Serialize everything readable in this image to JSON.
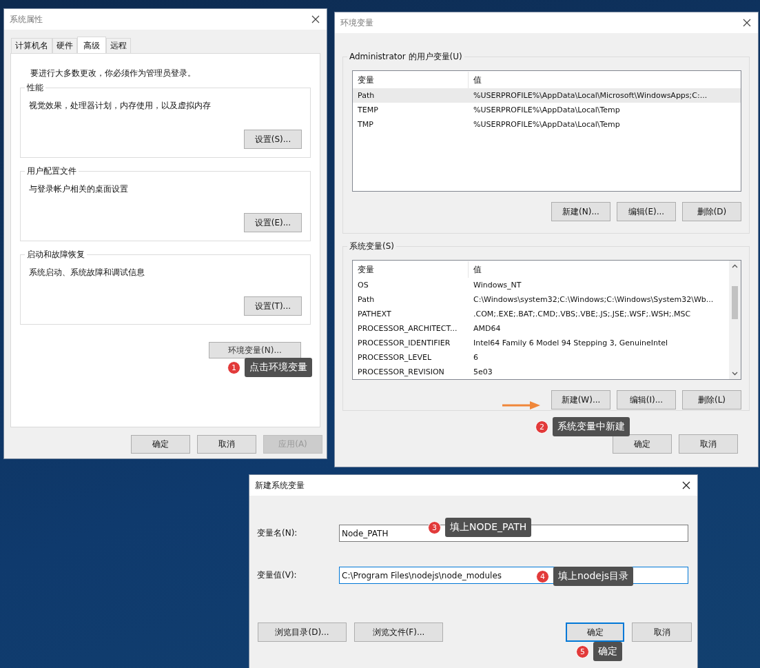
{
  "system_properties": {
    "title": "系统属性",
    "tabs": [
      {
        "label": "计算机名",
        "selected": false
      },
      {
        "label": "硬件",
        "selected": false
      },
      {
        "label": "高级",
        "selected": true
      },
      {
        "label": "远程",
        "selected": false
      }
    ],
    "notice": "要进行大多数更改，你必须作为管理员登录。",
    "groups": [
      {
        "title": "性能",
        "description": "视觉效果，处理器计划，内存使用，以及虚拟内存",
        "button": "设置(S)..."
      },
      {
        "title": "用户配置文件",
        "description": "与登录帐户相关的桌面设置",
        "button": "设置(E)..."
      },
      {
        "title": "启动和故障恢复",
        "description": "系统启动、系统故障和调试信息",
        "button": "设置(T)..."
      }
    ],
    "env_button": "环境变量(N)...",
    "buttons": [
      {
        "label": "确定",
        "disabled": false
      },
      {
        "label": "取消",
        "disabled": false
      },
      {
        "label": "应用(A)",
        "disabled": true
      }
    ]
  },
  "environment_variables": {
    "title": "环境变量",
    "user_group": {
      "title": "Administrator 的用户变量(U)",
      "columns": [
        "变量",
        "值"
      ],
      "rows": [
        {
          "name": "Path",
          "value": "%USERPROFILE%\\AppData\\Local\\Microsoft\\WindowsApps;C:...",
          "selected": true
        },
        {
          "name": "TEMP",
          "value": "%USERPROFILE%\\AppData\\Local\\Temp",
          "selected": false
        },
        {
          "name": "TMP",
          "value": "%USERPROFILE%\\AppData\\Local\\Temp",
          "selected": false
        }
      ],
      "buttons": [
        "新建(N)...",
        "编辑(E)...",
        "删除(D)"
      ]
    },
    "system_group": {
      "title": "系统变量(S)",
      "columns": [
        "变量",
        "值"
      ],
      "rows": [
        {
          "name": "OS",
          "value": "Windows_NT",
          "selected": false
        },
        {
          "name": "Path",
          "value": "C:\\Windows\\system32;C:\\Windows;C:\\Windows\\System32\\Wb...",
          "selected": false
        },
        {
          "name": "PATHEXT",
          "value": ".COM;.EXE;.BAT;.CMD;.VBS;.VBE;.JS;.JSE;.WSF;.WSH;.MSC",
          "selected": false
        },
        {
          "name": "PROCESSOR_ARCHITECT...",
          "value": "AMD64",
          "selected": false
        },
        {
          "name": "PROCESSOR_IDENTIFIER",
          "value": "Intel64 Family 6 Model 94 Stepping 3, GenuineIntel",
          "selected": false
        },
        {
          "name": "PROCESSOR_LEVEL",
          "value": "6",
          "selected": false
        },
        {
          "name": "PROCESSOR_REVISION",
          "value": "5e03",
          "selected": false
        }
      ],
      "buttons": [
        "新建(W)...",
        "编辑(I)...",
        "删除(L)"
      ]
    },
    "buttons": [
      "确定",
      "取消"
    ]
  },
  "new_variable": {
    "title": "新建系统变量",
    "fields": [
      {
        "label": "变量名(N):",
        "value": "Node_PATH"
      },
      {
        "label": "变量值(V):",
        "value": "C:\\Program Files\\nodejs\\node_modules"
      }
    ],
    "buttons": [
      {
        "label": "浏览目录(D)...",
        "focused": false
      },
      {
        "label": "浏览文件(F)...",
        "focused": false
      },
      {
        "label": "确定",
        "focused": true
      },
      {
        "label": "取消",
        "focused": false
      }
    ]
  },
  "annotations": [
    {
      "number": "1",
      "text": "点击环境变量"
    },
    {
      "number": "2",
      "text": "系统变量中新建"
    },
    {
      "number": "3",
      "text": "填上NODE_PATH"
    },
    {
      "number": "4",
      "text": "填上nodejs目录"
    },
    {
      "number": "5",
      "text": "确定"
    }
  ]
}
